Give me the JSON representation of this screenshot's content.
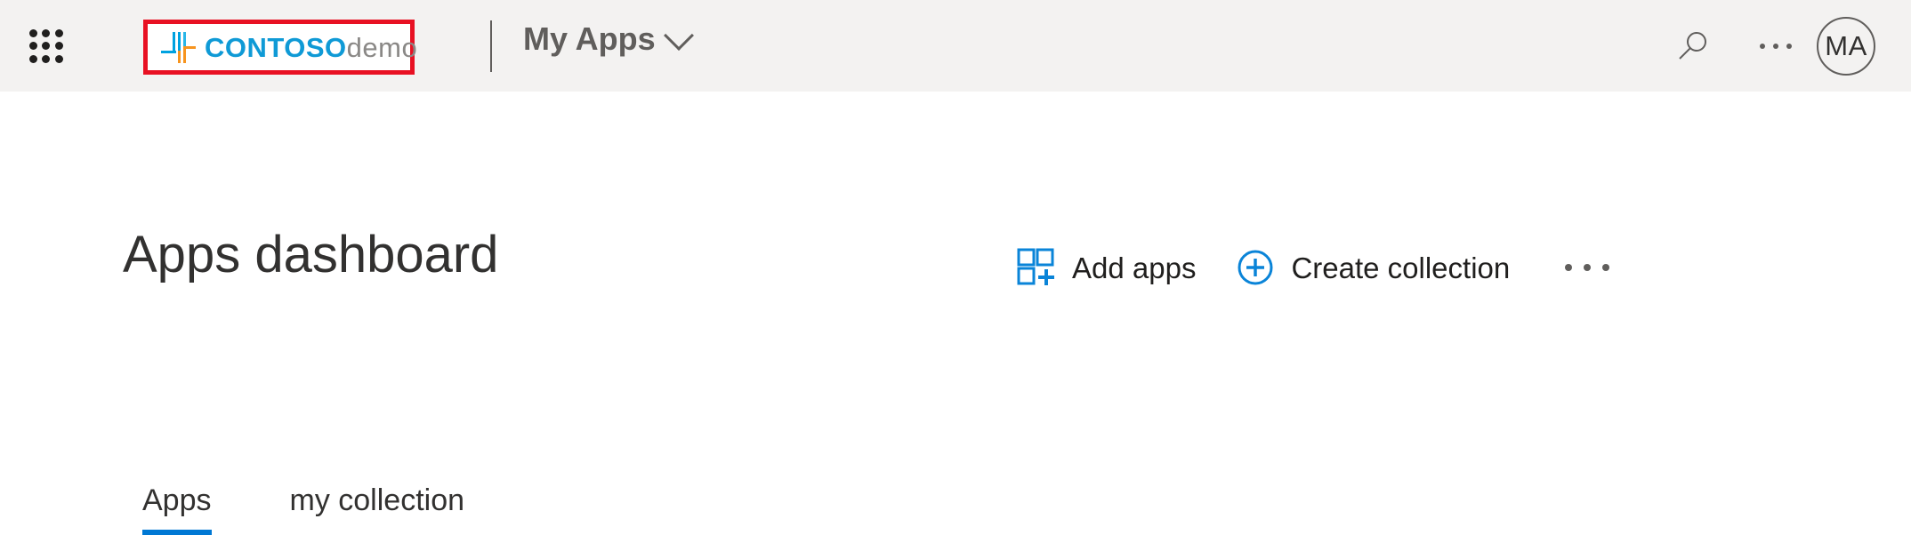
{
  "colors": {
    "header_bg": "#f3f2f1",
    "page_bg": "#ffffff",
    "accent_blue": "#0078d4",
    "icon_blue": "#0a84d8",
    "brand_blue": "#0f9ad6",
    "brand_orange": "#f7941e",
    "brand_gray": "#8a8886",
    "highlight_red": "#e81123",
    "text_primary": "#323130",
    "text_secondary": "#605e5c"
  },
  "header": {
    "waffle_icon": "app-launcher-waffle-icon",
    "brand": {
      "logo_icon": "contoso-logo-mark-icon",
      "name_strong": "CONTOSO",
      "name_light": "demo",
      "highlighted": true
    },
    "app_name": "My Apps",
    "app_name_chevron_icon": "chevron-down-icon",
    "actions": {
      "search_icon": "search-icon",
      "more_icon": "more-ellipsis-icon",
      "avatar_initials": "MA"
    }
  },
  "main": {
    "title": "Apps dashboard",
    "command_bar": {
      "add_apps": {
        "label": "Add apps",
        "icon": "add-apps-grid-plus-icon"
      },
      "create_collection": {
        "label": "Create collection",
        "icon": "circle-plus-icon"
      },
      "more_icon": "more-ellipsis-icon"
    },
    "tabs": [
      {
        "label": "Apps",
        "active": true
      },
      {
        "label": "my collection",
        "active": false
      }
    ]
  }
}
